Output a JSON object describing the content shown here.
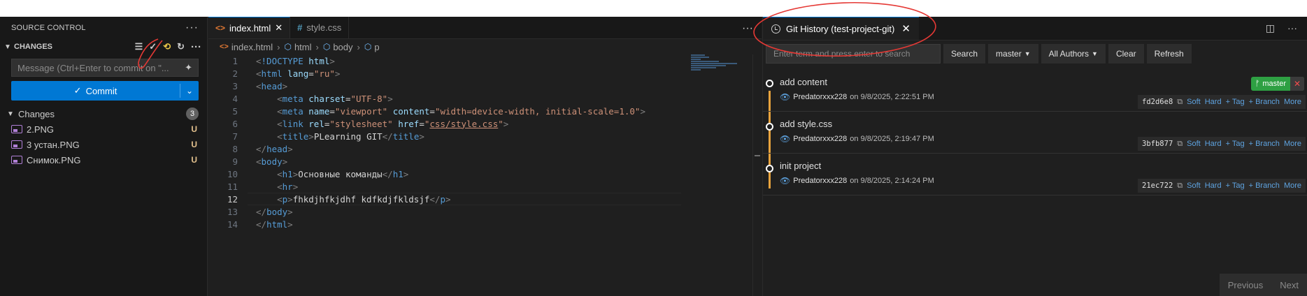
{
  "sidebar": {
    "title": "SOURCE CONTROL",
    "section": "CHANGES",
    "message_placeholder": "Message (Ctrl+Enter to commit on \"...",
    "commit_label": "Commit",
    "group_label": "Changes",
    "group_count": "3",
    "files": [
      {
        "name": "2.PNG",
        "status": "U"
      },
      {
        "name": "3 устан.PNG",
        "status": "U"
      },
      {
        "name": "Снимок.PNG",
        "status": "U"
      }
    ]
  },
  "editor": {
    "tabs": [
      {
        "label": "index.html",
        "active": true
      },
      {
        "label": "style.css",
        "active": false
      }
    ],
    "breadcrumb": [
      "index.html",
      "html",
      "body",
      "p"
    ],
    "current_line": 12
  },
  "history": {
    "tab_label": "Git History (test-project-git)",
    "search_placeholder": "Enter term and press enter to search",
    "buttons": {
      "search": "Search",
      "branch": "master",
      "authors": "All Authors",
      "clear": "Clear",
      "refresh": "Refresh"
    },
    "branch_tag": "master",
    "commits": [
      {
        "message": "add content",
        "author": "Predatorxxx228",
        "date": "on 9/8/2025, 2:22:51 PM",
        "hash": "fd2d6e8"
      },
      {
        "message": "add style.css",
        "author": "Predatorxxx228",
        "date": "on 9/8/2025, 2:19:47 PM",
        "hash": "3bfb877"
      },
      {
        "message": "init project",
        "author": "Predatorxxx228",
        "date": "on 9/8/2025, 2:14:24 PM",
        "hash": "21ec722"
      }
    ],
    "actions": [
      "Soft",
      "Hard",
      "+ Tag",
      "+ Branch",
      "More"
    ],
    "pager": {
      "previous": "Previous",
      "next": "Next"
    }
  },
  "colors": {
    "accent": "#0078d4",
    "graph_rail": "#e8a33d",
    "branch_tag": "#2ea043",
    "annotation": "#e53935"
  }
}
